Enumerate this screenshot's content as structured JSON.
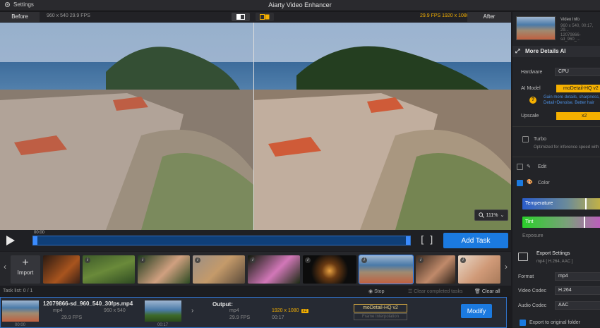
{
  "app": {
    "title": "Aiarty Video Enhancer",
    "settings_label": "Settings"
  },
  "compare": {
    "before_label": "Before",
    "before_info": "960 x 540  29.9 FPS",
    "after_label": "After",
    "after_info": "29.9 FPS  1920 x 1080",
    "zoom": "111%"
  },
  "player": {
    "time": "00:00",
    "add_task": "Add Task"
  },
  "import": {
    "label": "Import"
  },
  "tasklist": {
    "count_label": "Task list:  0 / 1",
    "stop_label": "Stop",
    "clear_completed_label": "Clear completed tasks",
    "clear_all_label": "Clear all"
  },
  "task": {
    "filename": "12079866-sd_960_540_30fps.mp4",
    "in_time_start": "00:00",
    "in_time_end": "00:17",
    "in_format": "mp4",
    "in_res": "960 x 540",
    "in_fps": "29.9 FPS",
    "output_label": "Output:",
    "out_format": "mp4",
    "out_res": "1920 x 1080",
    "out_scale": "x2",
    "out_fps": "29.9 FPS",
    "out_duration": "00:17",
    "model": "moDetail-HQ  v2",
    "interp": "Frame Interpolation",
    "modify_label": "Modify"
  },
  "panel": {
    "video_info_label": "Video Info",
    "video_info_res": "960 x 540, 00:17, 29...",
    "video_info_name": "12079866-sd_960_...",
    "section_title": "More Details AI",
    "hardware_label": "Hardware",
    "hardware_value": "CPU",
    "ai_model_label": "AI Model",
    "ai_model_value": "moDetail-HQ  v2",
    "ai_model_hint_1": "Gain more details, sharpness,",
    "ai_model_hint_2": "Detail+Denoise. Better hair",
    "upscale_label": "Upscale",
    "upscale_value": "x2",
    "turbo_label": "Turbo",
    "turbo_hint": "Optimized for inference speed with",
    "edit_label": "Edit",
    "color_label": "Color",
    "temperature_label": "Temperature",
    "tint_label": "Tint",
    "exposure_label": "Exposure",
    "temperature_level": 0.78,
    "tint_level": 0.76,
    "export_settings_label": "Export Settings",
    "export_settings_sub": "mp4 [ H.264, AAC ]",
    "format_label": "Format",
    "format_value": "mp4",
    "video_codec_label": "Video Codec",
    "video_codec_value": "H.264",
    "audio_codec_label": "Audio Codec",
    "audio_codec_value": "AAC",
    "export_original_label": "Export to original folder"
  },
  "colors": {
    "accent": "#1b7ae0",
    "highlight": "#f5b000"
  }
}
